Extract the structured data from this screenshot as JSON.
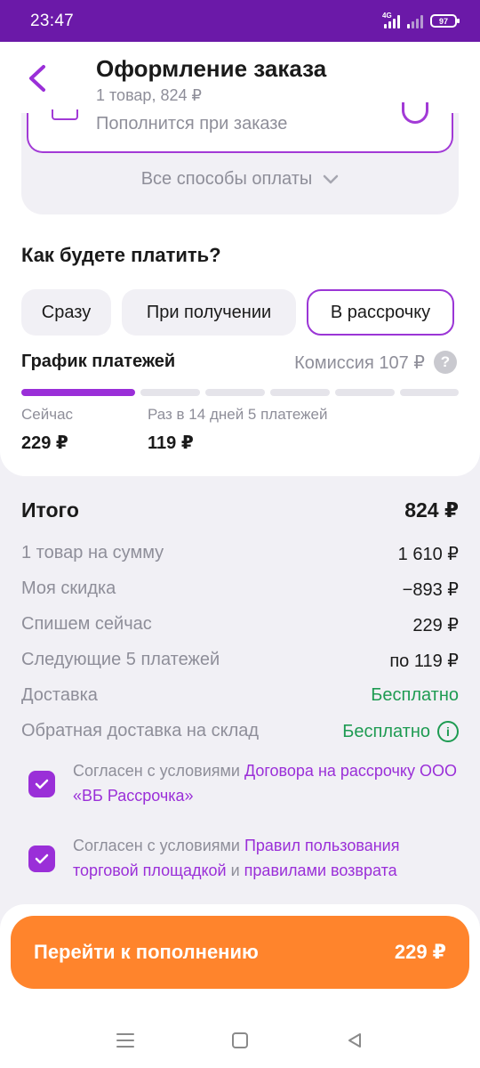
{
  "status_bar": {
    "time": "23:47",
    "network": "4G",
    "battery": "97"
  },
  "header": {
    "title": "Оформление заказа",
    "subtitle": "1 товар, 824 ₽"
  },
  "payment_method": {
    "partial_text": "Пополнится при заказе",
    "all_methods_label": "Все способы оплаты"
  },
  "how_pay": {
    "title": "Как будете платить?",
    "options": [
      {
        "label": "Сразу",
        "selected": false
      },
      {
        "label": "При получении",
        "selected": false
      },
      {
        "label": "В рассрочку",
        "selected": true
      }
    ]
  },
  "schedule": {
    "title": "График платежей",
    "commission": "Комиссия 107 ₽",
    "progress_segments": 6,
    "progress_filled": 1,
    "now_label": "Сейчас",
    "now_amount": "229 ₽",
    "later_label": "Раз в 14 дней 5 платежей",
    "later_amount": "119 ₽"
  },
  "summary": {
    "total_label": "Итого",
    "total_value": "824 ₽",
    "rows": [
      {
        "label": "1 товар на сумму",
        "value": "1 610 ₽"
      },
      {
        "label": "Моя скидка",
        "value": "−893 ₽"
      },
      {
        "label": "Спишем сейчас",
        "value": "229 ₽"
      },
      {
        "label": "Следующие 5 платежей",
        "value": "по 119 ₽"
      },
      {
        "label": "Доставка",
        "value": "Бесплатно"
      },
      {
        "label": "Обратная доставка на склад",
        "value": "Бесплатно"
      }
    ]
  },
  "agreements": [
    {
      "prefix": "Согласен с условиями ",
      "link1": "Договора на рассрочку ООО «ВБ Рассрочка»",
      "checked": true
    },
    {
      "prefix": "Согласен с условиями ",
      "link1": "Правил пользования торговой площадкой",
      "mid": " и ",
      "link2": "правилами возврата",
      "checked": true
    }
  ],
  "cta": {
    "label": "Перейти к пополнению",
    "amount": "229 ₽"
  },
  "colors": {
    "brand": "#6b19a8",
    "accent": "#9a2fd8",
    "cta": "#ff842c",
    "green": "#1e9b52"
  },
  "icons": [
    "back-arrow-icon",
    "chevron-down-icon",
    "question-icon",
    "info-icon",
    "check-icon",
    "menu-icon",
    "home-icon",
    "back-triangle-icon"
  ]
}
